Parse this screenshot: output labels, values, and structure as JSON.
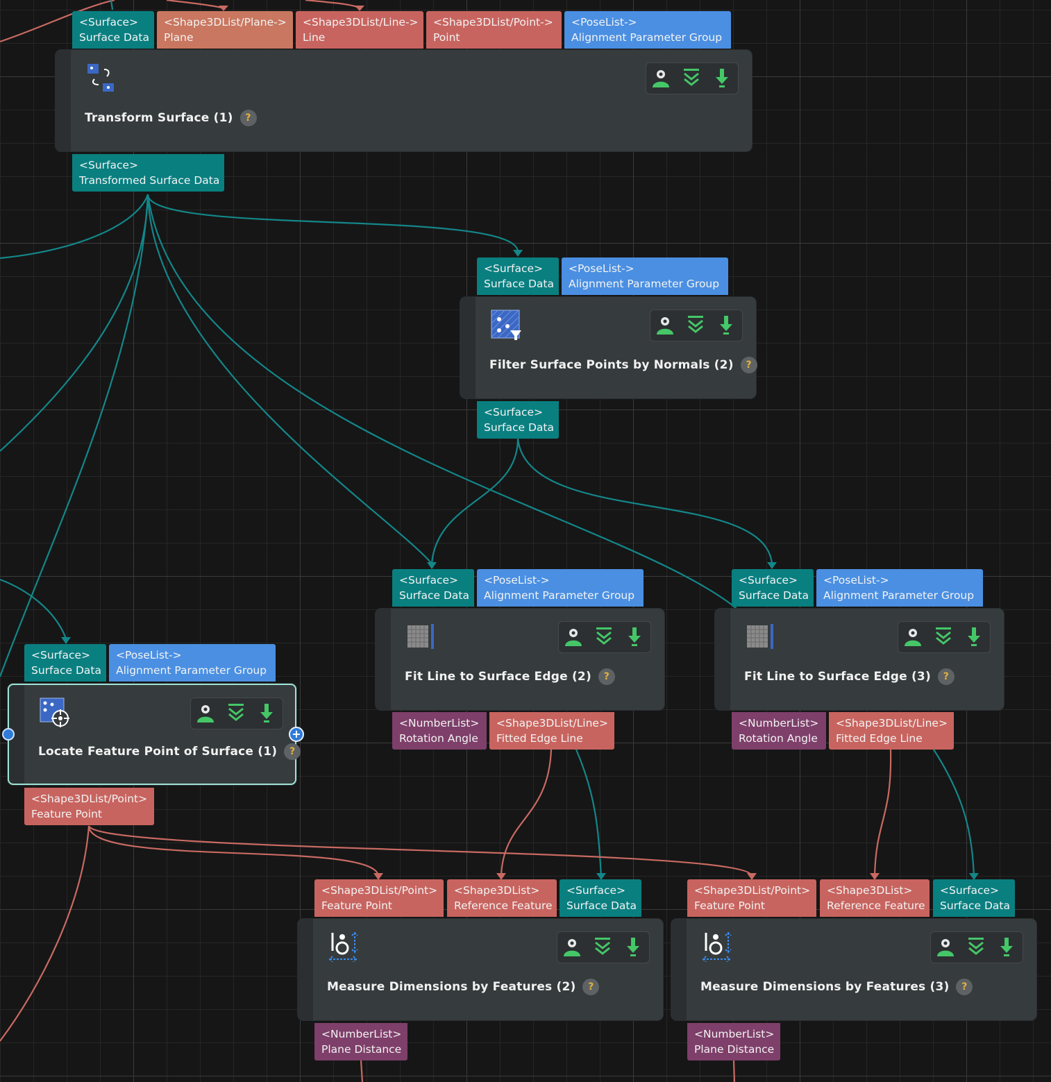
{
  "colors": {
    "surface": "#0a7f80",
    "shape": "#c8645f",
    "plane": "#c97760",
    "pose": "#4a8fe2",
    "number": "#7e3f6a",
    "wire_teal": "#13878a",
    "wire_red": "#c96a62",
    "canvas": "#161616"
  },
  "nodes": {
    "transform": {
      "title": "Transform Surface (1)",
      "icon": "transform-surface-icon",
      "inputs": [
        {
          "type": "<Surface>",
          "name": "Surface Data"
        },
        {
          "type": "<Shape3DList/Plane->",
          "name": "Plane"
        },
        {
          "type": "<Shape3DList/Line->",
          "name": "Line"
        },
        {
          "type": "<Shape3DList/Point->",
          "name": "Point"
        },
        {
          "type": "<PoseList->",
          "name": "Alignment Parameter Group"
        }
      ],
      "outputs": [
        {
          "type": "<Surface>",
          "name": "Transformed Surface Data"
        }
      ]
    },
    "filter": {
      "title": "Filter Surface Points by Normals (2)",
      "icon": "filter-points-icon",
      "inputs": [
        {
          "type": "<Surface>",
          "name": "Surface Data"
        },
        {
          "type": "<PoseList->",
          "name": "Alignment Parameter Group"
        }
      ],
      "outputs": [
        {
          "type": "<Surface>",
          "name": "Surface Data"
        }
      ]
    },
    "fit2": {
      "title": "Fit Line to Surface Edge (2)",
      "icon": "fit-line-icon",
      "inputs": [
        {
          "type": "<Surface>",
          "name": "Surface Data"
        },
        {
          "type": "<PoseList->",
          "name": "Alignment Parameter Group"
        }
      ],
      "outputs": [
        {
          "type": "<NumberList>",
          "name": "Rotation Angle"
        },
        {
          "type": "<Shape3DList/Line>",
          "name": "Fitted Edge Line"
        }
      ]
    },
    "fit3": {
      "title": "Fit Line to Surface Edge (3)",
      "icon": "fit-line-icon",
      "inputs": [
        {
          "type": "<Surface>",
          "name": "Surface Data"
        },
        {
          "type": "<PoseList->",
          "name": "Alignment Parameter Group"
        }
      ],
      "outputs": [
        {
          "type": "<NumberList>",
          "name": "Rotation Angle"
        },
        {
          "type": "<Shape3DList/Line>",
          "name": "Fitted Edge Line"
        }
      ]
    },
    "locate": {
      "title": "Locate Feature Point of Surface (1)",
      "icon": "locate-feature-icon",
      "inputs": [
        {
          "type": "<Surface>",
          "name": "Surface Data"
        },
        {
          "type": "<PoseList->",
          "name": "Alignment Parameter Group"
        }
      ],
      "outputs": [
        {
          "type": "<Shape3DList/Point>",
          "name": "Feature Point"
        }
      ]
    },
    "measure2": {
      "title": "Measure Dimensions by Features (2)",
      "icon": "measure-dimensions-icon",
      "inputs": [
        {
          "type": "<Shape3DList/Point>",
          "name": "Feature Point"
        },
        {
          "type": "<Shape3DList>",
          "name": "Reference Feature"
        },
        {
          "type": "<Surface>",
          "name": "Surface Data"
        }
      ],
      "outputs": [
        {
          "type": "<NumberList>",
          "name": "Plane Distance"
        }
      ]
    },
    "measure3": {
      "title": "Measure Dimensions by Features (3)",
      "icon": "measure-dimensions-icon",
      "inputs": [
        {
          "type": "<Shape3DList/Point>",
          "name": "Feature Point"
        },
        {
          "type": "<Shape3DList>",
          "name": "Reference Feature"
        },
        {
          "type": "<Surface>",
          "name": "Surface Data"
        }
      ],
      "outputs": [
        {
          "type": "<NumberList>",
          "name": "Plane Distance"
        }
      ]
    }
  },
  "controls": [
    "visualize-output-icon",
    "collapse-ports-icon",
    "save-output-icon"
  ],
  "help_symbol": "?"
}
